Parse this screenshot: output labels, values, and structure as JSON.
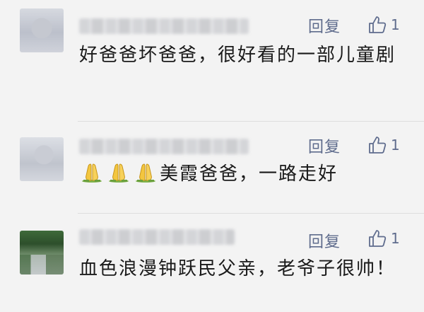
{
  "comments": [
    {
      "reply_label": "回复",
      "like_count": "1",
      "text": "好爸爸坏爸爸，很好看的一部儿童剧"
    },
    {
      "reply_label": "回复",
      "like_count": "1",
      "emoji": [
        "folded-hands-icon",
        "folded-hands-icon",
        "folded-hands-icon"
      ],
      "text": "美霞爸爸，一路走好"
    },
    {
      "reply_label": "回复",
      "like_count": "1",
      "text": "血色浪漫钟跃民父亲，老爷子很帅！"
    }
  ],
  "colors": {
    "background": "#f3f3f3",
    "link": "#5f6c8d",
    "text": "#1a1a1a",
    "divider": "#dedede"
  }
}
